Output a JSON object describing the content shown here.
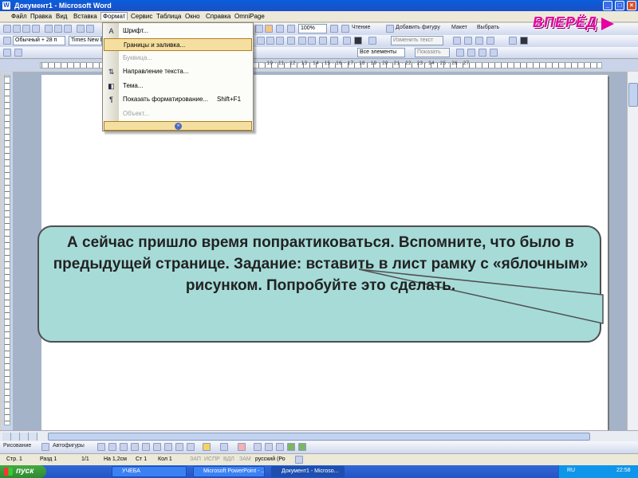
{
  "window": {
    "title": "Документ1 - Microsoft Word",
    "minimize": "_",
    "maximize": "□",
    "close": "×"
  },
  "menubar": {
    "items": [
      "Файл",
      "Правка",
      "Вид",
      "Вставка",
      "Формат",
      "Сервис",
      "Таблица",
      "Окно",
      "Справка",
      "OmniPage"
    ]
  },
  "toolbar": {
    "zoom": "100%",
    "reading": "Чтение",
    "style": "Обычный + 28 п",
    "font": "Times New Ro",
    "add_shape": "Добавить фигуру",
    "layout": "Макет",
    "select": "Выбрать",
    "change_text": "Изменить текст",
    "all_items": "Все элементы",
    "show": "Показать"
  },
  "ruler": {
    "numbers": "· 10 · 11 · 12 · 13 · 14 · 15 · 16 · 17 · 18 · 19 · 20 · 21 · 22 · 23 · 24 · 25 · 26 · 27"
  },
  "format_menu": {
    "items": [
      {
        "label": "Шрифт...",
        "icon": "A",
        "state": "normal",
        "shortcut": ""
      },
      {
        "label": "Границы и заливка...",
        "icon": "",
        "state": "highlighted",
        "shortcut": ""
      },
      {
        "label": "Буквица...",
        "icon": "",
        "state": "disabled",
        "shortcut": ""
      },
      {
        "label": "Направление текста...",
        "icon": "⇅",
        "state": "normal",
        "shortcut": ""
      },
      {
        "label": "Тема...",
        "icon": "◧",
        "state": "normal",
        "shortcut": ""
      },
      {
        "label": "Показать форматирование...",
        "icon": "¶",
        "state": "normal",
        "shortcut": "Shift+F1"
      },
      {
        "label": "Объект...",
        "icon": "",
        "state": "disabled",
        "shortcut": ""
      }
    ],
    "expand_icon": "»"
  },
  "logo": {
    "text": "ВПЕРЁД"
  },
  "callout": {
    "text": "А сейчас пришло время попрактиковаться. Вспомните, что было в предыдущей странице. Задание: вставить в лист рамку с «яблочным» рисунком. Попробуйте это сделать.",
    "fill_color": "#a6dbd8",
    "border_color": "#4f4f4f"
  },
  "drawbar": {
    "drawing": "Рисование",
    "autoshapes": "Автофигуры"
  },
  "statusbar": {
    "page": "Стр. 1",
    "section": "Разд 1",
    "pages": "1/1",
    "position": "На 1,2см",
    "line": "Ст 1",
    "column": "Кол 1",
    "rec": "ЗАП",
    "trk": "ИСПР",
    "ext": "ВДЛ",
    "ovr": "ЗАМ",
    "language": "русский (Ро"
  },
  "taskbar": {
    "start": "пуск",
    "tasks": [
      "УЧЕБА",
      "Microsoft PowerPoint - ...",
      "Документ1 - Microso..."
    ],
    "language": "RU",
    "clock": "22:58"
  }
}
